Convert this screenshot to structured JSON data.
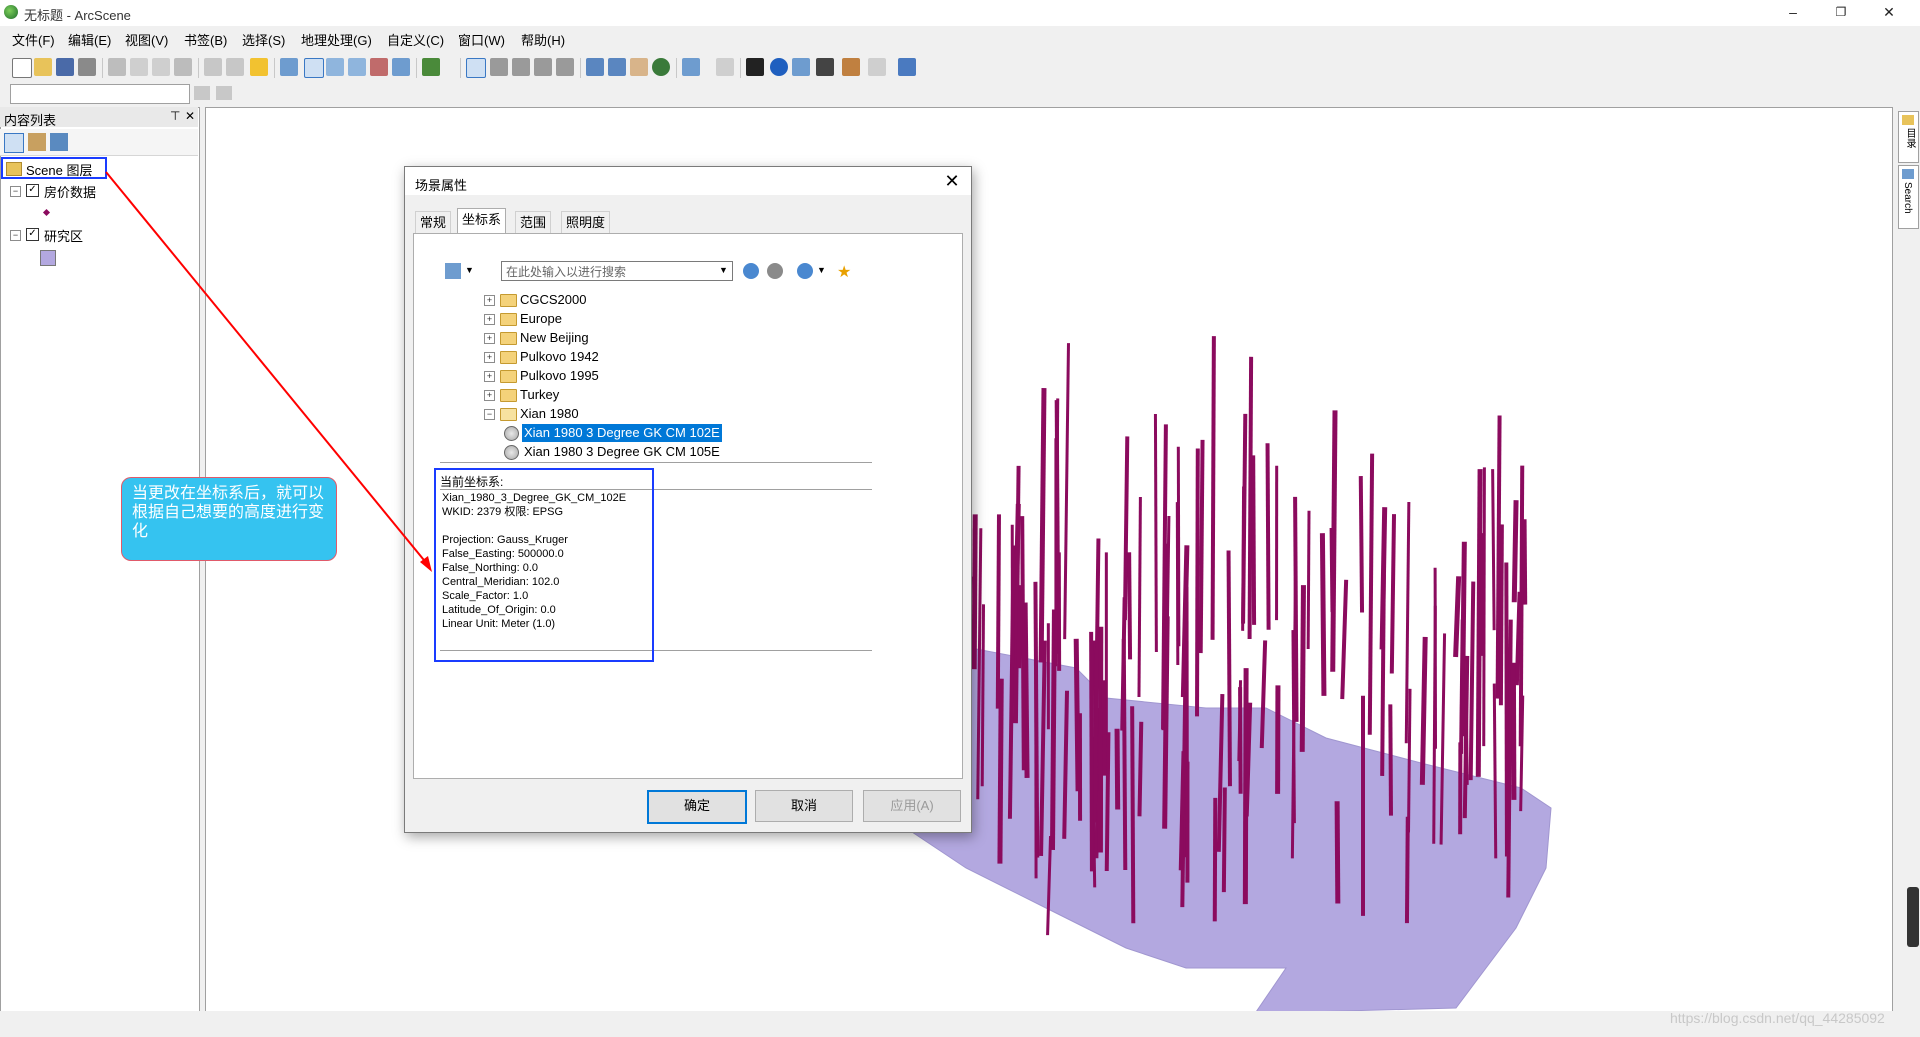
{
  "window": {
    "title": "无标题 - ArcScene",
    "min_label": "–",
    "restore_label": "❐",
    "close_label": "✕"
  },
  "menu": [
    "文件(F)",
    "编辑(E)",
    "视图(V)",
    "书签(B)",
    "选择(S)",
    "地理处理(G)",
    "自定义(C)",
    "窗口(W)",
    "帮助(H)"
  ],
  "toc": {
    "title": "内容列表",
    "pin_label": "⊤",
    "close_label": "✕",
    "root_label": "Scene 图层",
    "layers": [
      {
        "name": "房价数据",
        "checked": true,
        "symbol": "point"
      },
      {
        "name": "研究区",
        "checked": true,
        "symbol": "polygon"
      }
    ]
  },
  "right_dock": {
    "catalog_label": "目录",
    "search_label": "Search"
  },
  "dialog": {
    "title": "场景属性",
    "close_label": "✕",
    "tabs": [
      "常规",
      "坐标系",
      "范围",
      "照明度"
    ],
    "active_tab": "坐标系",
    "search_placeholder": "在此处输入以进行搜索",
    "tree": [
      {
        "label": "CGCS2000",
        "type": "folder",
        "expanded": false
      },
      {
        "label": "Europe",
        "type": "folder",
        "expanded": false
      },
      {
        "label": "New Beijing",
        "type": "folder",
        "expanded": false
      },
      {
        "label": "Pulkovo 1942",
        "type": "folder",
        "expanded": false
      },
      {
        "label": "Pulkovo 1995",
        "type": "folder",
        "expanded": false
      },
      {
        "label": "Turkey",
        "type": "folder",
        "expanded": false
      },
      {
        "label": "Xian 1980",
        "type": "folder",
        "expanded": true
      },
      {
        "label": "Xian 1980 3 Degree GK CM 102E",
        "type": "crs",
        "selected": true
      },
      {
        "label": "Xian 1980 3 Degree GK CM 105E",
        "type": "crs",
        "selected": false
      }
    ],
    "current_cs_label": "当前坐标系:",
    "current_cs_text": "Xian_1980_3_Degree_GK_CM_102E\nWKID: 2379 权限: EPSG\n\nProjection: Gauss_Kruger\nFalse_Easting: 500000.0\nFalse_Northing: 0.0\nCentral_Meridian: 102.0\nScale_Factor: 1.0\nLatitude_Of_Origin: 0.0\nLinear Unit: Meter (1.0)",
    "buttons": {
      "ok": "确定",
      "cancel": "取消",
      "apply": "应用(A)"
    }
  },
  "annotation": {
    "callout_text": "当更改在坐标系后，就可以根据自己想要的高度进行变化"
  },
  "watermark": "https://blog.csdn.net/qq_44285092",
  "colors": {
    "polygon": "#b3a8e0",
    "points": "#8b0b5e",
    "accent": "#0078d7",
    "highlight": "#1a3cff",
    "arrow": "#ff0000"
  }
}
